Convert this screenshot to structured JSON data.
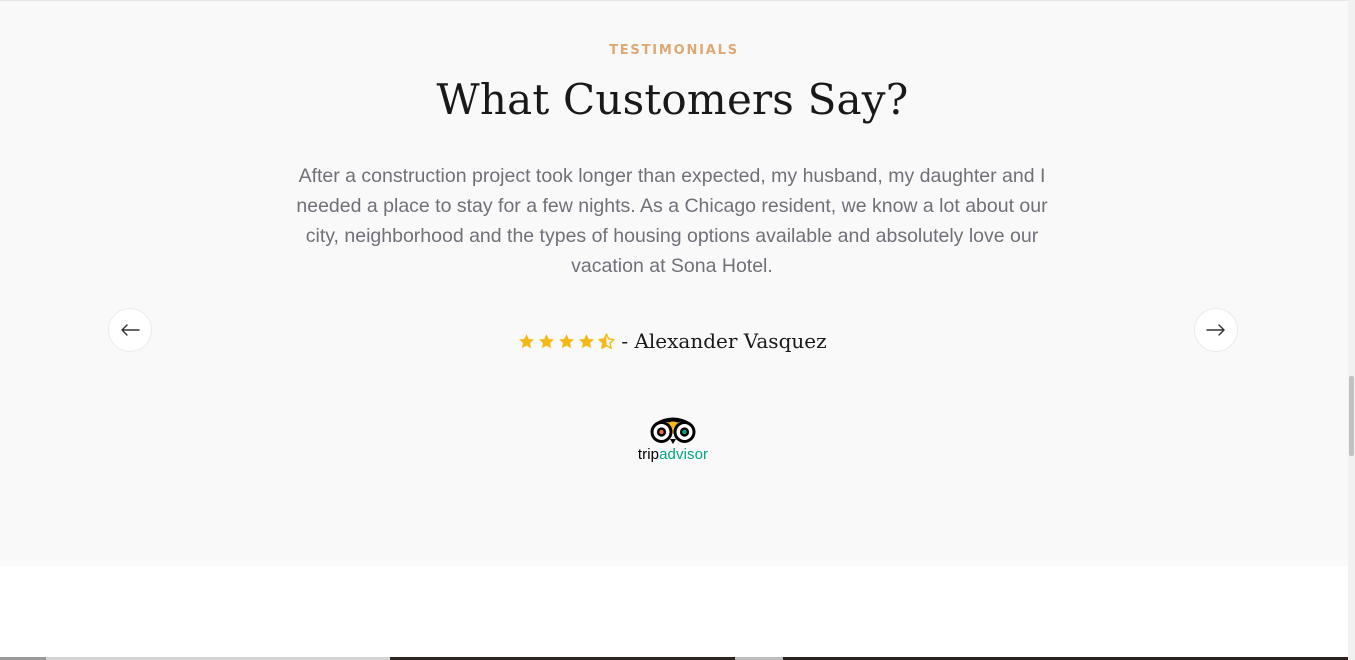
{
  "testimonials": {
    "section_label": "TESTIMONIALS",
    "title": "What Customers Say?",
    "quote": "After a construction project took longer than expected, my husband, my daughter and I needed a place to stay for a few nights. As a Chicago resident, we know a lot about our city, neighborhood and the types of housing options available and absolutely love our vacation at Sona Hotel.",
    "rating": {
      "value": 4.5,
      "max": 5,
      "star_color": "#f5b917"
    },
    "author": "- Alexander Vasquez",
    "brand": {
      "icon": "tripadvisor-owl-icon",
      "text_trip": "trip",
      "text_advisor": "advisor",
      "advisor_color": "#00a680"
    },
    "prev_icon": "arrow-left-icon",
    "next_icon": "arrow-right-icon",
    "accent_color": "#dfa974"
  }
}
